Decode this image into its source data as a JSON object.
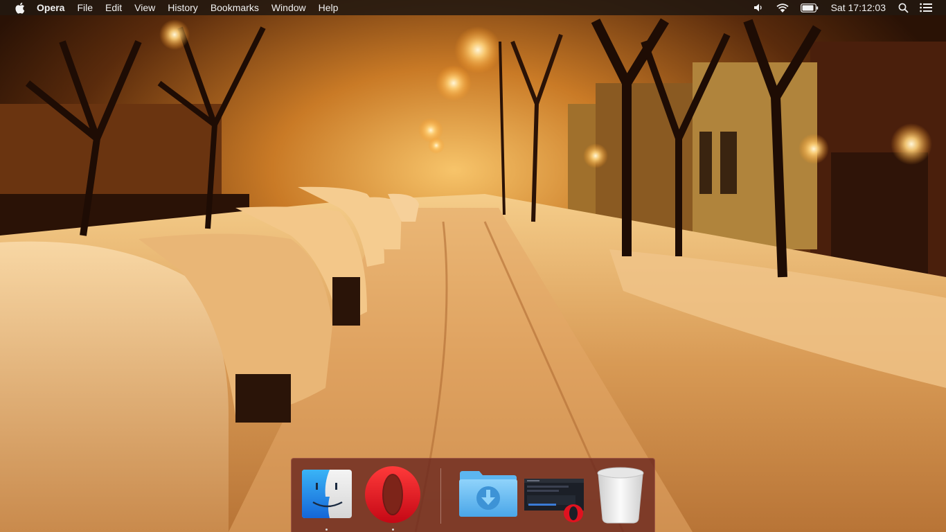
{
  "menubar": {
    "apple_icon": "apple-logo-icon",
    "app_name": "Opera",
    "menus": [
      "File",
      "Edit",
      "View",
      "History",
      "Bookmarks",
      "Window",
      "Help"
    ],
    "status_icons": [
      "volume-icon",
      "wifi-icon",
      "battery-icon"
    ],
    "clock": "Sat 17:12:03",
    "right_icons": [
      "spotlight-search-icon",
      "notification-center-icon"
    ]
  },
  "desktop": {
    "wallpaper": "snowy street at night with parked cars and street lamps"
  },
  "dock": {
    "apps": [
      {
        "name": "Finder",
        "icon": "finder-icon",
        "running": true
      },
      {
        "name": "Opera",
        "icon": "opera-icon",
        "running": true
      }
    ],
    "stacks": [
      {
        "name": "Downloads",
        "icon": "downloads-folder-icon"
      },
      {
        "name": "Opera Window",
        "icon": "minimized-window-thumbnail-icon"
      },
      {
        "name": "Trash",
        "icon": "trash-icon"
      }
    ]
  },
  "colors": {
    "menubar_bg": "#221810",
    "dock_bg": "#69261e",
    "opera_red": "#e0121f",
    "finder_blue": "#1e7fe0",
    "folder_blue": "#5cb6f0"
  }
}
